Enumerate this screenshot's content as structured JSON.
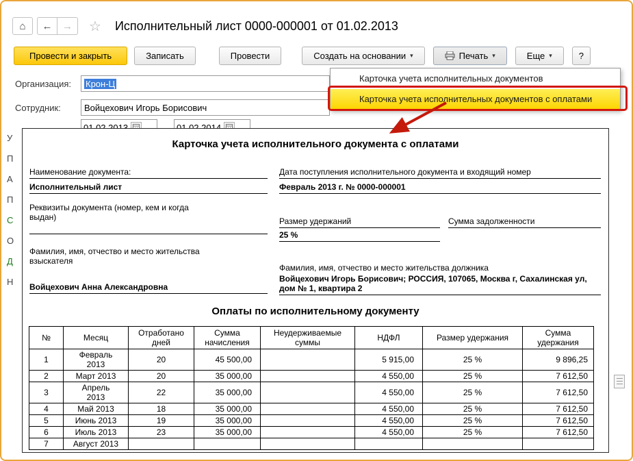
{
  "window": {
    "title": "Исполнительный лист 0000-000001 от 01.02.2013"
  },
  "icons": {
    "home": "⌂",
    "back": "←",
    "forward": "→",
    "star": "☆",
    "caret": "▾"
  },
  "toolbar": {
    "post_close": "Провести и закрыть",
    "write": "Записать",
    "post": "Провести",
    "create_based_on": "Создать на основании",
    "print": "Печать",
    "more": "Еще",
    "help": "?"
  },
  "form": {
    "organization_label": "Организация:",
    "organization_value": "Крон-Ц",
    "employee_label": "Сотрудник:",
    "employee_value": "Войцехович Игорь Борисович",
    "date_from": "01.02.2013",
    "date_to": "01.02.2014",
    "left_strip": [
      {
        "char": "У",
        "green": false
      },
      {
        "char": "П",
        "green": false
      },
      {
        "char": "А",
        "green": false
      },
      {
        "char": "П",
        "green": false
      },
      {
        "char": "С",
        "green": true
      },
      {
        "char": "О",
        "green": false
      },
      {
        "char": "Д",
        "green": true
      },
      {
        "char": "Н",
        "green": false
      }
    ]
  },
  "print_menu": {
    "item1": "Карточка учета исполнительных документов",
    "item2": "Карточка учета исполнительных документов с оплатами"
  },
  "document": {
    "title": "Карточка учета исполнительного документа с оплатами",
    "name_label": "Наименование документа:",
    "name_value": "Исполнительный лист",
    "receipt_label": "Дата поступления исполнительного документа и входящий номер",
    "receipt_value": "Февраль 2013 г. № 0000-000001",
    "requisites_label": "Реквизиты документа (номер, кем и когда выдан)",
    "withhold_rate_label": "Размер удержаний",
    "withhold_rate_value": "25 %",
    "debt_label": "Сумма задолженности",
    "claimant_label": "Фамилия, имя, отчество и место жительства взыскателя",
    "claimant_value": "Войцехович Анна Александровна",
    "debtor_label": "Фамилия, имя, отчество и место жительства должника",
    "debtor_value": "Войцехович Игорь Борисович; РОССИЯ, 107065, Москва г, Сахалинская ул, дом № 1, квартира 2",
    "payments_title": "Оплаты по исполнительному документу",
    "table": {
      "headers": [
        "№",
        "Месяц",
        "Отработано дней",
        "Сумма начисления",
        "Неудерживаемые суммы",
        "НДФЛ",
        "Размер удержания",
        "Сумма удержания"
      ],
      "rows": [
        [
          "1",
          "Февраль 2013",
          "20",
          "45 500,00",
          "",
          "5 915,00",
          "25 %",
          "9 896,25"
        ],
        [
          "2",
          "Март 2013",
          "20",
          "35 000,00",
          "",
          "4 550,00",
          "25 %",
          "7 612,50"
        ],
        [
          "3",
          "Апрель 2013",
          "22",
          "35 000,00",
          "",
          "4 550,00",
          "25 %",
          "7 612,50"
        ],
        [
          "4",
          "Май 2013",
          "18",
          "35 000,00",
          "",
          "4 550,00",
          "25 %",
          "7 612,50"
        ],
        [
          "5",
          "Июнь 2013",
          "19",
          "35 000,00",
          "",
          "4 550,00",
          "25 %",
          "7 612,50"
        ],
        [
          "6",
          "Июль 2013",
          "23",
          "35 000,00",
          "",
          "4 550,00",
          "25 %",
          "7 612,50"
        ],
        [
          "7",
          "Август 2013",
          "",
          "",
          "",
          "",
          "",
          ""
        ]
      ]
    }
  },
  "annotation_colors": {
    "frame": "#e9a63a",
    "highlight_box": "#d2180e",
    "arrow": "#c41a0c"
  }
}
